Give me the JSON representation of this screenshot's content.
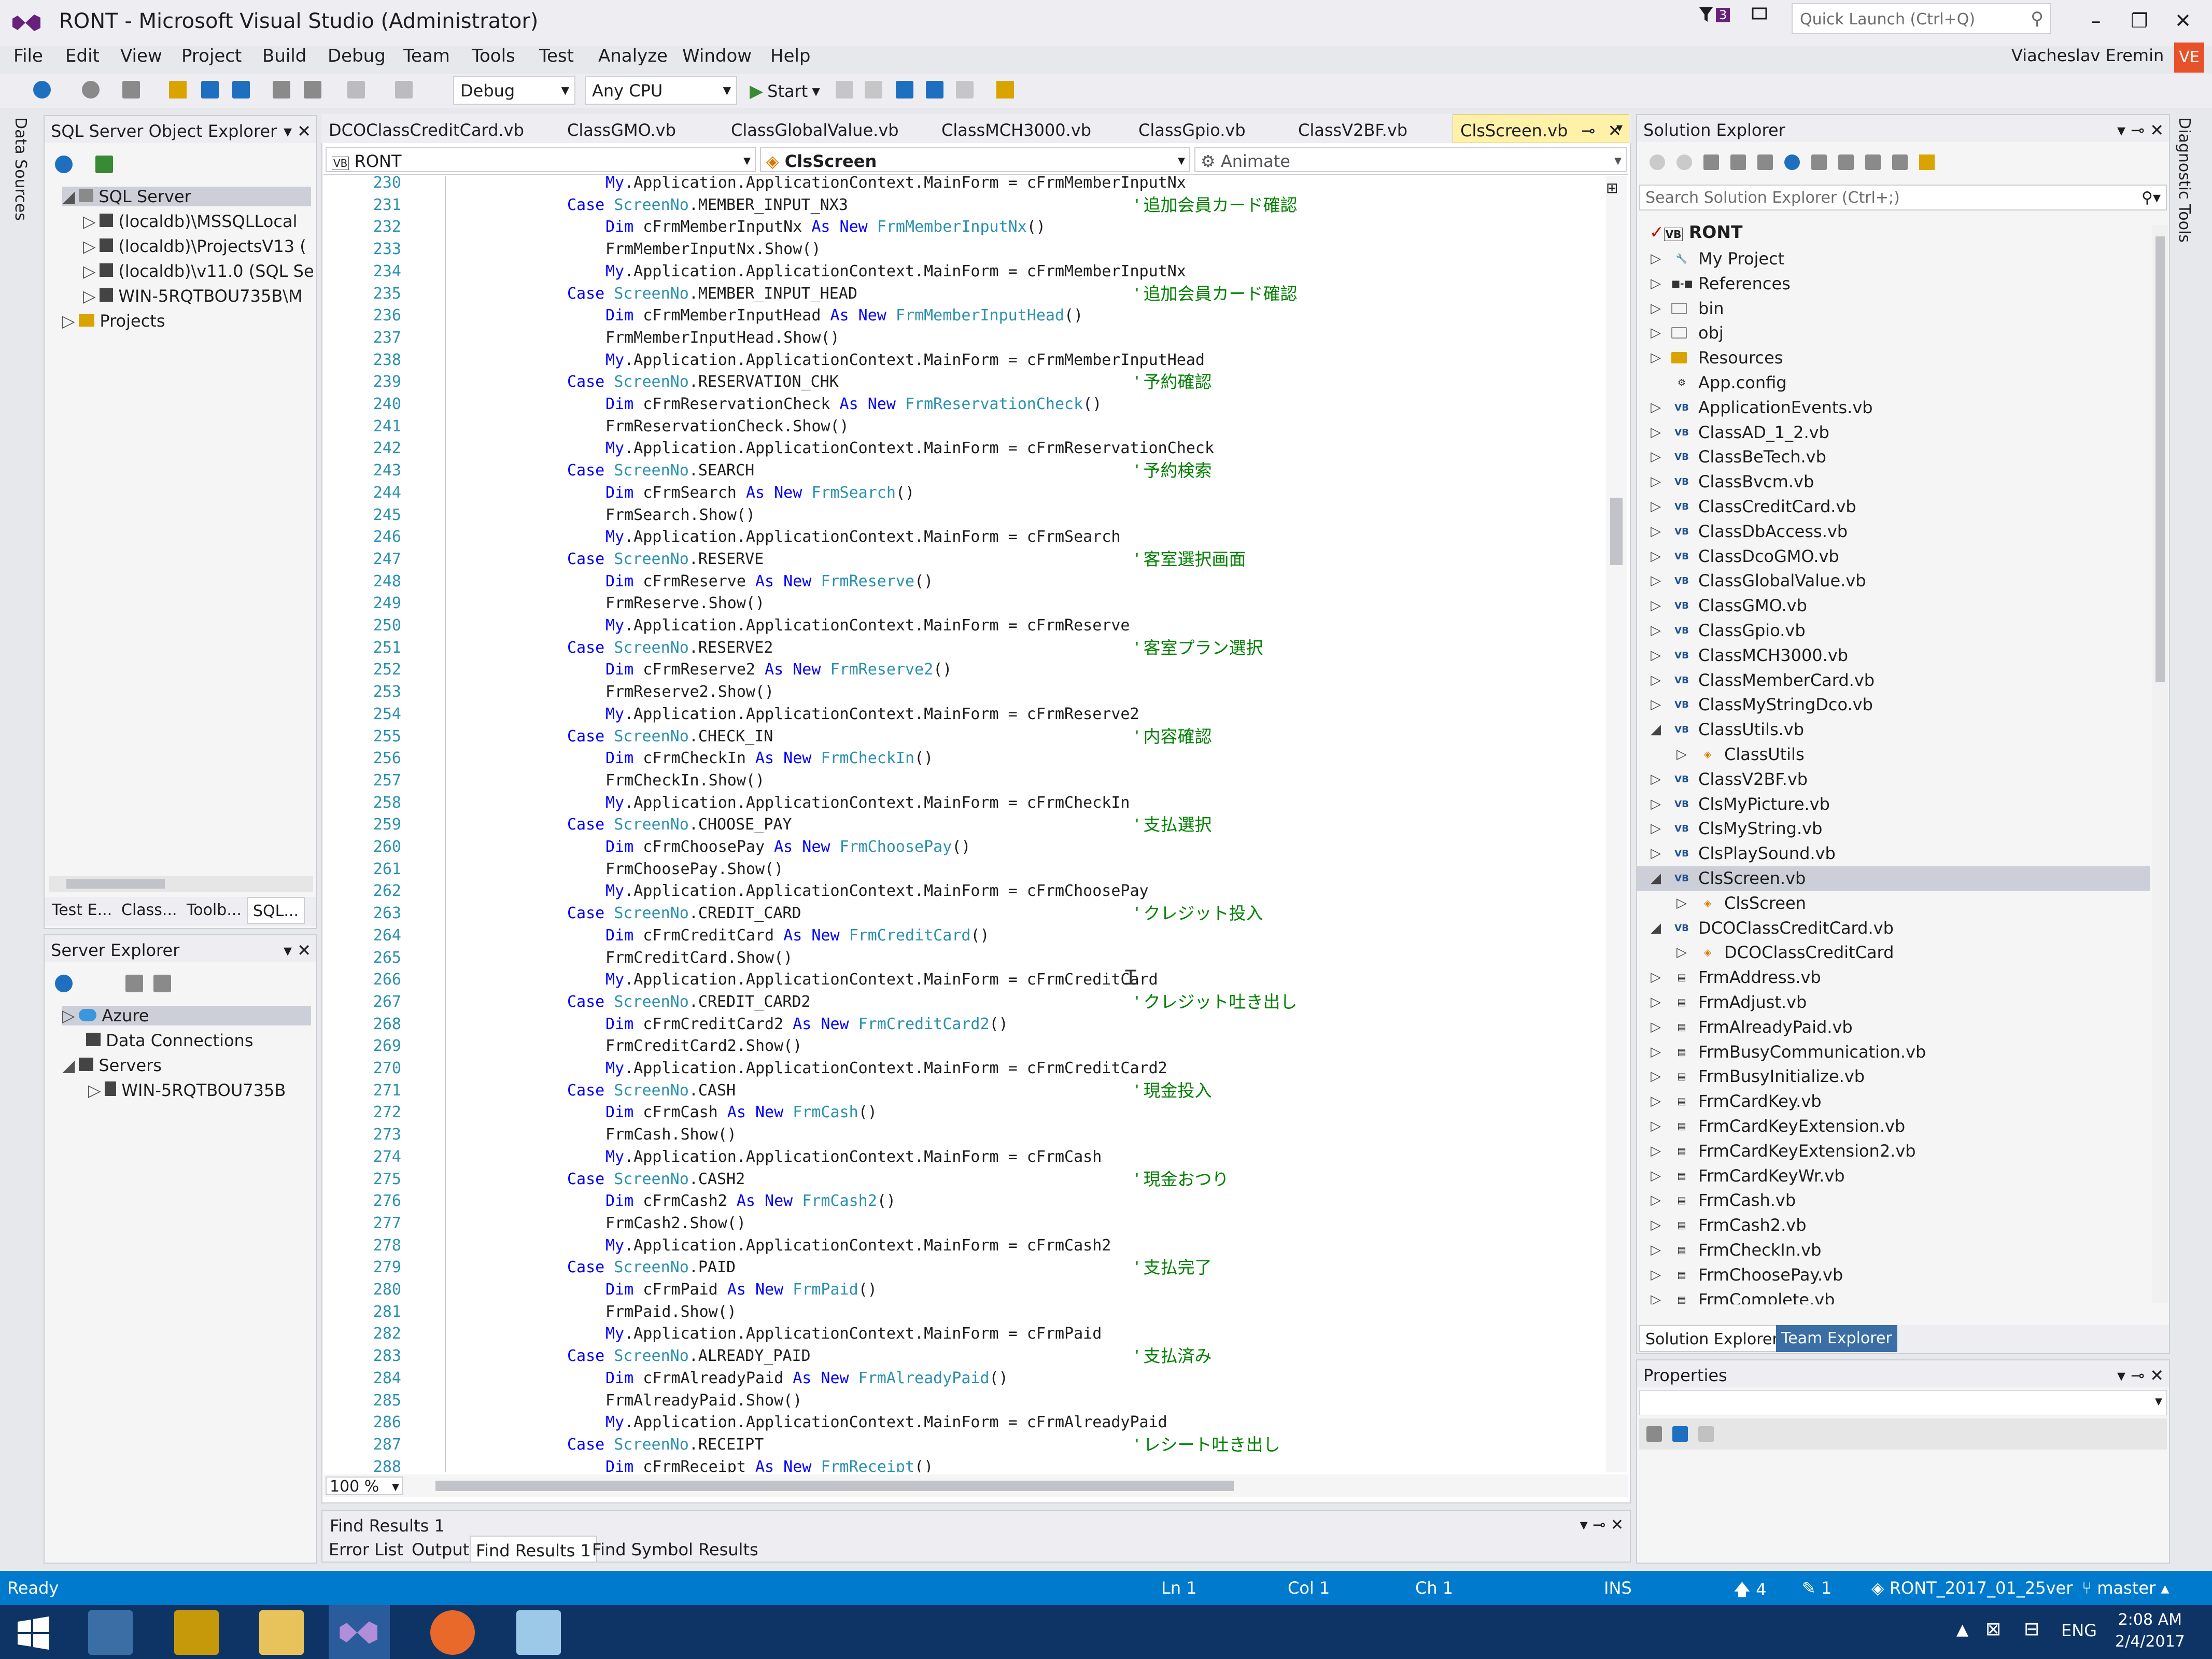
{
  "window": {
    "title": "RONT - Microsoft Visual Studio (Administrator)",
    "filter_badge": "3",
    "quick_launch_placeholder": "Quick Launch (Ctrl+Q)",
    "minimize": "–",
    "restore": "❐",
    "close": "✕"
  },
  "menu": [
    "File",
    "Edit",
    "View",
    "Project",
    "Build",
    "Debug",
    "Team",
    "Tools",
    "Test",
    "Analyze",
    "Window",
    "Help"
  ],
  "user": {
    "name": "Viacheslav Eremin",
    "initials": "VE"
  },
  "toolbar": {
    "config": "Debug",
    "platform": "Any CPU",
    "start": "Start"
  },
  "side_tabs": {
    "left": "Data Sources",
    "right": "Diagnostic Tools"
  },
  "sql_explorer": {
    "title": "SQL Server Object Explorer",
    "root": "SQL Server",
    "items": [
      "(localdb)\\MSSQLLocal",
      "(localdb)\\ProjectsV13 (",
      "(localdb)\\v11.0 (SQL Se",
      "WIN-5RQTBOU735B\\M"
    ],
    "projects": "Projects",
    "tabs": [
      "Test E...",
      "Class...",
      "Toolb...",
      "SQL..."
    ]
  },
  "server_explorer": {
    "title": "Server Explorer",
    "items": [
      "Azure",
      "Data Connections",
      "Servers",
      "WIN-5RQTBOU735B"
    ]
  },
  "doc_tabs": [
    "DCOClassCreditCard.vb",
    "ClassGMO.vb",
    "ClassGlobalValue.vb",
    "ClassMCH3000.vb",
    "ClassGpio.vb",
    "ClassV2BF.vb",
    "ClsScreen.vb"
  ],
  "navbar": {
    "project": "RONT",
    "class": "ClsScreen",
    "member": "Animate"
  },
  "code": [
    {
      "n": "230",
      "kind": "assign",
      "v": "cFrmMemberInputNx"
    },
    {
      "n": "231",
      "kind": "case",
      "v": "MEMBER_INPUT_NX3",
      "c": "' 追加会員カード確認"
    },
    {
      "n": "232",
      "kind": "dim",
      "v": "cFrmMemberInputNx",
      "t": "FrmMemberInputNx"
    },
    {
      "n": "233",
      "kind": "show",
      "v": "FrmMemberInputNx"
    },
    {
      "n": "234",
      "kind": "assign",
      "v": "cFrmMemberInputNx"
    },
    {
      "n": "235",
      "kind": "case",
      "v": "MEMBER_INPUT_HEAD",
      "c": "' 追加会員カード確認"
    },
    {
      "n": "236",
      "kind": "dim",
      "v": "cFrmMemberInputHead",
      "t": "FrmMemberInputHead"
    },
    {
      "n": "237",
      "kind": "show",
      "v": "FrmMemberInputHead"
    },
    {
      "n": "238",
      "kind": "assign",
      "v": "cFrmMemberInputHead"
    },
    {
      "n": "239",
      "kind": "case",
      "v": "RESERVATION_CHK",
      "c": "' 予約確認"
    },
    {
      "n": "240",
      "kind": "dim",
      "v": "cFrmReservationCheck",
      "t": "FrmReservationCheck"
    },
    {
      "n": "241",
      "kind": "show",
      "v": "FrmReservationCheck"
    },
    {
      "n": "242",
      "kind": "assign",
      "v": "cFrmReservationCheck"
    },
    {
      "n": "243",
      "kind": "case",
      "v": "SEARCH",
      "c": "' 予約検索"
    },
    {
      "n": "244",
      "kind": "dim",
      "v": "cFrmSearch",
      "t": "FrmSearch"
    },
    {
      "n": "245",
      "kind": "show",
      "v": "FrmSearch"
    },
    {
      "n": "246",
      "kind": "assign",
      "v": "cFrmSearch"
    },
    {
      "n": "247",
      "kind": "case",
      "v": "RESERVE",
      "c": "' 客室選択画面"
    },
    {
      "n": "248",
      "kind": "dim",
      "v": "cFrmReserve",
      "t": "FrmReserve"
    },
    {
      "n": "249",
      "kind": "show",
      "v": "FrmReserve"
    },
    {
      "n": "250",
      "kind": "assign",
      "v": "cFrmReserve"
    },
    {
      "n": "251",
      "kind": "case",
      "v": "RESERVE2",
      "c": "' 客室プラン選択"
    },
    {
      "n": "252",
      "kind": "dim",
      "v": "cFrmReserve2",
      "t": "FrmReserve2"
    },
    {
      "n": "253",
      "kind": "show",
      "v": "FrmReserve2"
    },
    {
      "n": "254",
      "kind": "assign",
      "v": "cFrmReserve2"
    },
    {
      "n": "255",
      "kind": "case",
      "v": "CHECK_IN",
      "c": "' 内容確認"
    },
    {
      "n": "256",
      "kind": "dim",
      "v": "cFrmCheckIn",
      "t": "FrmCheckIn"
    },
    {
      "n": "257",
      "kind": "show",
      "v": "FrmCheckIn"
    },
    {
      "n": "258",
      "kind": "assign",
      "v": "cFrmCheckIn"
    },
    {
      "n": "259",
      "kind": "case",
      "v": "CHOOSE_PAY",
      "c": "' 支払選択"
    },
    {
      "n": "260",
      "kind": "dim",
      "v": "cFrmChoosePay",
      "t": "FrmChoosePay"
    },
    {
      "n": "261",
      "kind": "show",
      "v": "FrmChoosePay"
    },
    {
      "n": "262",
      "kind": "assign",
      "v": "cFrmChoosePay"
    },
    {
      "n": "263",
      "kind": "case",
      "v": "CREDIT_CARD",
      "c": "' クレジット投入"
    },
    {
      "n": "264",
      "kind": "dim",
      "v": "cFrmCreditCard",
      "t": "FrmCreditCard"
    },
    {
      "n": "265",
      "kind": "show",
      "v": "FrmCreditCard"
    },
    {
      "n": "266",
      "kind": "assign",
      "v": "cFrmCreditCard"
    },
    {
      "n": "267",
      "kind": "case",
      "v": "CREDIT_CARD2",
      "c": "' クレジット吐き出し"
    },
    {
      "n": "268",
      "kind": "dim",
      "v": "cFrmCreditCard2",
      "t": "FrmCreditCard2"
    },
    {
      "n": "269",
      "kind": "show",
      "v": "FrmCreditCard2"
    },
    {
      "n": "270",
      "kind": "assign",
      "v": "cFrmCreditCard2"
    },
    {
      "n": "271",
      "kind": "case",
      "v": "CASH",
      "c": "' 現金投入"
    },
    {
      "n": "272",
      "kind": "dim",
      "v": "cFrmCash",
      "t": "FrmCash"
    },
    {
      "n": "273",
      "kind": "show",
      "v": "FrmCash"
    },
    {
      "n": "274",
      "kind": "assign",
      "v": "cFrmCash"
    },
    {
      "n": "275",
      "kind": "case",
      "v": "CASH2",
      "c": "' 現金おつり"
    },
    {
      "n": "276",
      "kind": "dim",
      "v": "cFrmCash2",
      "t": "FrmCash2"
    },
    {
      "n": "277",
      "kind": "show",
      "v": "FrmCash2"
    },
    {
      "n": "278",
      "kind": "assign",
      "v": "cFrmCash2"
    },
    {
      "n": "279",
      "kind": "case",
      "v": "PAID",
      "c": "' 支払完了"
    },
    {
      "n": "280",
      "kind": "dim",
      "v": "cFrmPaid",
      "t": "FrmPaid"
    },
    {
      "n": "281",
      "kind": "show",
      "v": "FrmPaid"
    },
    {
      "n": "282",
      "kind": "assign",
      "v": "cFrmPaid"
    },
    {
      "n": "283",
      "kind": "case",
      "v": "ALREADY_PAID",
      "c": "' 支払済み"
    },
    {
      "n": "284",
      "kind": "dim",
      "v": "cFrmAlreadyPaid",
      "t": "FrmAlreadyPaid"
    },
    {
      "n": "285",
      "kind": "show",
      "v": "FrmAlreadyPaid"
    },
    {
      "n": "286",
      "kind": "assign",
      "v": "cFrmAlreadyPaid"
    },
    {
      "n": "287",
      "kind": "case",
      "v": "RECEIPT",
      "c": "' レシート吐き出し"
    },
    {
      "n": "288",
      "kind": "dim",
      "v": "cFrmReceipt",
      "t": "FrmReceipt"
    }
  ],
  "code_tokens": {
    "case": "Case",
    "screen": "ScreenNo",
    "dim": "Dim",
    "as": "As",
    "new": "New",
    "my": "My",
    "ctx": ".Application.ApplicationContext.MainForm = ",
    "show": ".Show()"
  },
  "zoom": "100 %",
  "find_results": {
    "title": "Find Results 1",
    "tabs": [
      "Error List",
      "Output",
      "Find Results 1",
      "Find Symbol Results"
    ]
  },
  "solution_explorer": {
    "title": "Solution Explorer",
    "search_placeholder": "Search Solution Explorer (Ctrl+;)",
    "root": "RONT",
    "items": [
      {
        "label": "My Project",
        "icon": "wrench-icon",
        "lvl": 1
      },
      {
        "label": "References",
        "icon": "references-icon",
        "lvl": 1
      },
      {
        "label": "bin",
        "icon": "folder-icon",
        "lvl": 1
      },
      {
        "label": "obj",
        "icon": "folder-icon",
        "lvl": 1
      },
      {
        "label": "Resources",
        "icon": "folder-icon",
        "lvl": 1
      },
      {
        "label": "App.config",
        "icon": "config-icon",
        "lvl": 1
      },
      {
        "label": "ApplicationEvents.vb",
        "icon": "vb-icon",
        "lvl": 1
      },
      {
        "label": "ClassAD_1_2.vb",
        "icon": "vb-icon",
        "lvl": 1
      },
      {
        "label": "ClassBeTech.vb",
        "icon": "vb-icon",
        "lvl": 1
      },
      {
        "label": "ClassBvcm.vb",
        "icon": "vb-icon",
        "lvl": 1
      },
      {
        "label": "ClassCreditCard.vb",
        "icon": "vb-icon",
        "lvl": 1
      },
      {
        "label": "ClassDbAccess.vb",
        "icon": "vb-icon",
        "lvl": 1
      },
      {
        "label": "ClassDcoGMO.vb",
        "icon": "vb-icon",
        "lvl": 1
      },
      {
        "label": "ClassGlobalValue.vb",
        "icon": "vb-icon",
        "lvl": 1
      },
      {
        "label": "ClassGMO.vb",
        "icon": "vb-icon",
        "lvl": 1
      },
      {
        "label": "ClassGpio.vb",
        "icon": "vb-icon",
        "lvl": 1
      },
      {
        "label": "ClassMCH3000.vb",
        "icon": "vb-icon",
        "lvl": 1
      },
      {
        "label": "ClassMemberCard.vb",
        "icon": "vb-icon",
        "lvl": 1
      },
      {
        "label": "ClassMyStringDco.vb",
        "icon": "vb-icon",
        "lvl": 1
      },
      {
        "label": "ClassUtils.vb",
        "icon": "vb-icon",
        "lvl": 1
      },
      {
        "label": "ClassUtils",
        "icon": "class-icon",
        "lvl": 2
      },
      {
        "label": "ClassV2BF.vb",
        "icon": "vb-icon",
        "lvl": 1
      },
      {
        "label": "ClsMyPicture.vb",
        "icon": "vb-icon",
        "lvl": 1
      },
      {
        "label": "ClsMyString.vb",
        "icon": "vb-icon",
        "lvl": 1
      },
      {
        "label": "ClsPlaySound.vb",
        "icon": "vb-icon",
        "lvl": 1
      },
      {
        "label": "ClsScreen.vb",
        "icon": "vb-icon",
        "lvl": 1
      },
      {
        "label": "ClsScreen",
        "icon": "class-icon",
        "lvl": 2
      },
      {
        "label": "DCOClassCreditCard.vb",
        "icon": "vb-icon",
        "lvl": 1
      },
      {
        "label": "DCOClassCreditCard",
        "icon": "class-icon",
        "lvl": 2
      },
      {
        "label": "FrmAddress.vb",
        "icon": "form-icon",
        "lvl": 1
      },
      {
        "label": "FrmAdjust.vb",
        "icon": "form-icon",
        "lvl": 1
      },
      {
        "label": "FrmAlreadyPaid.vb",
        "icon": "form-icon",
        "lvl": 1
      },
      {
        "label": "FrmBusyCommunication.vb",
        "icon": "form-icon",
        "lvl": 1
      },
      {
        "label": "FrmBusyInitialize.vb",
        "icon": "form-icon",
        "lvl": 1
      },
      {
        "label": "FrmCardKey.vb",
        "icon": "form-icon",
        "lvl": 1
      },
      {
        "label": "FrmCardKeyExtension.vb",
        "icon": "form-icon",
        "lvl": 1
      },
      {
        "label": "FrmCardKeyExtension2.vb",
        "icon": "form-icon",
        "lvl": 1
      },
      {
        "label": "FrmCardKeyWr.vb",
        "icon": "form-icon",
        "lvl": 1
      },
      {
        "label": "FrmCash.vb",
        "icon": "form-icon",
        "lvl": 1
      },
      {
        "label": "FrmCash2.vb",
        "icon": "form-icon",
        "lvl": 1
      },
      {
        "label": "FrmCheckIn.vb",
        "icon": "form-icon",
        "lvl": 1
      },
      {
        "label": "FrmChoosePay.vb",
        "icon": "form-icon",
        "lvl": 1
      },
      {
        "label": "FrmComplete.vb",
        "icon": "form-icon",
        "lvl": 1
      }
    ],
    "tabs": [
      "Solution Explorer",
      "Team Explorer"
    ]
  },
  "properties": {
    "title": "Properties"
  },
  "status": {
    "ready": "Ready",
    "ln": "Ln 1",
    "col": "Col 1",
    "ch": "Ch 1",
    "ins": "INS",
    "up": "4",
    "edits": "1",
    "repo": "RONT_2017_01_25ver",
    "branch": "master"
  },
  "taskbar": {
    "lang": "ENG",
    "time": "2:08 AM",
    "date": "2/4/2017"
  },
  "colors": {
    "accent": "#007acc",
    "keyword": "#0000ff",
    "type": "#2b91af",
    "comment": "#008000",
    "taskbar": "#0e3466"
  }
}
